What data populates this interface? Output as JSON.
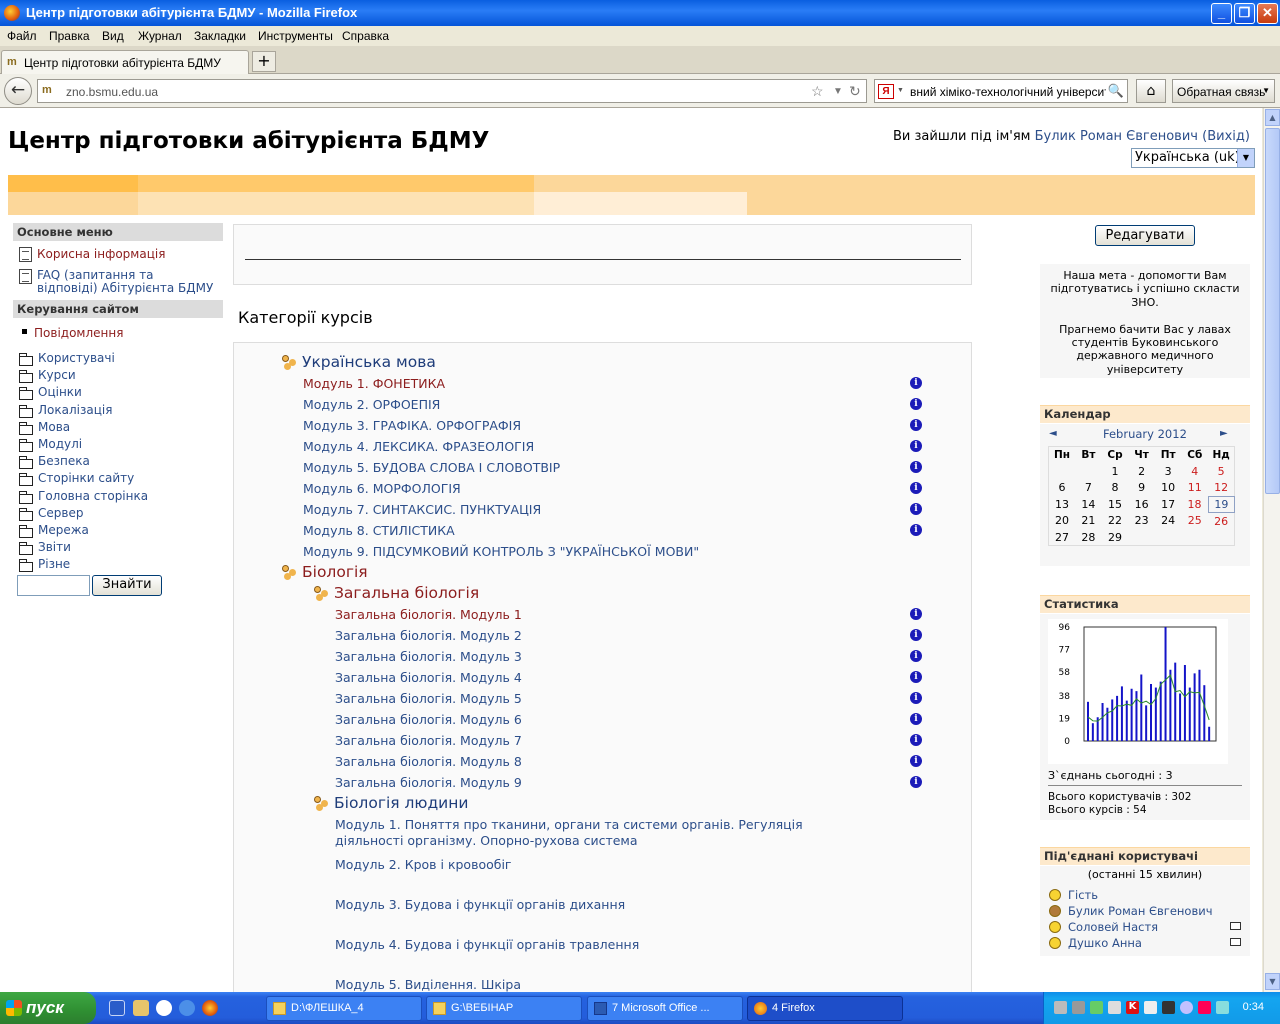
{
  "window": {
    "title": "Центр підготовки абітурієнта БДМУ - Mozilla Firefox",
    "buttons": [
      "_",
      "❐",
      "✕"
    ]
  },
  "menu": [
    "Файл",
    "Правка",
    "Вид",
    "Журнал",
    "Закладки",
    "Инструменты",
    "Справка"
  ],
  "tab": {
    "label": "Центр підготовки абітурієнта БДМУ",
    "favicon": "m",
    "new_tab": "+"
  },
  "nav": {
    "url": "zno.bsmu.edu.ua",
    "search_text": "вний хіміко-технологічний університет",
    "search_engine": "Я",
    "feedback": "Обратная связь"
  },
  "header": {
    "site_title": "Центр підготовки абітурієнта БДМУ",
    "login_prefix": "Ви зайшли під ім'ям",
    "user": "Булик Роман Євгенович",
    "logout": "(Вихід)",
    "language": "Українська (uk)"
  },
  "left": {
    "main_menu_title": "Основне меню",
    "main_menu": [
      {
        "label": "Корисна інформація"
      },
      {
        "label": "FAQ (запитання та відповіді) Абітурієнта БДМУ"
      }
    ],
    "admin_title": "Керування сайтом",
    "admin_items": [
      "Повідомлення",
      "Користувачі",
      "Курси",
      "Оцінки",
      "Локалізація",
      "Мова",
      "Модулі",
      "Безпека",
      "Сторінки сайту",
      "Головна сторінка",
      "Сервер",
      "Мережа",
      "Звіти",
      "Різне"
    ],
    "search_button": "Знайти"
  },
  "main": {
    "categories_title": "Категорії курсів",
    "ukrainian": {
      "title": "Українська мова",
      "courses": [
        "Модуль 1. ФОНЕТИКА",
        "Модуль 2. ОРФОЕПІЯ",
        "Модуль 3. ГРАФІКА. ОРФОГРАФІЯ",
        "Модуль 4. ЛЕКСИКА. ФРАЗЕОЛОГІЯ",
        "Модуль 5. БУДОВА СЛОВА І СЛОВОТВІР",
        "Модуль 6. МОРФОЛОГІЯ",
        "Модуль 7. СИНТАКСИС. ПУНКТУАЦІЯ",
        "Модуль 8. СТИЛІСТИКА",
        "Модуль 9. ПІДСУМКОВИЙ КОНТРОЛЬ З \"УКРАЇНСЬКОЇ МОВИ\""
      ]
    },
    "biology": {
      "title": "Біологія"
    },
    "general_biology": {
      "title": "Загальна біологія",
      "courses": [
        "Загальна біологія. Модуль 1",
        "Загальна біологія. Модуль 2",
        "Загальна біологія. Модуль 3",
        "Загальна біологія. Модуль 4",
        "Загальна біологія. Модуль 5",
        "Загальна біологія. Модуль 6",
        "Загальна біологія. Модуль 7",
        "Загальна біологія. Модуль 8",
        "Загальна біологія. Модуль 9"
      ]
    },
    "human_biology": {
      "title": "Біологія людини",
      "courses": [
        "Модуль 1. Поняття про тканини, органи та системи органів. Регуляція",
        "діяльності організму. Опорно-рухова система",
        "Модуль 2. Кров і кровообіг",
        "Модуль 3. Будова і функції органів дихання",
        "Модуль 4. Будова і функції органів травлення",
        "Модуль 5. Виділення. Шкіра"
      ]
    },
    "info_icon": "i"
  },
  "right": {
    "edit_button": "Редагувати",
    "goal_text_1": "Наша мета - допомогти Вам підготуватись і успішно скласти ЗНО.",
    "goal_text_2": "Прагнемо бачити Вас у лавах студентів Буковинського державного медичного університету",
    "calendar": {
      "title": "Календар",
      "month": "February 2012",
      "prev": "◄",
      "next": "►",
      "days": [
        "Пн",
        "Вт",
        "Ср",
        "Чт",
        "Пт",
        "Сб",
        "Нд"
      ],
      "weeks": [
        [
          "",
          "",
          "1",
          "2",
          "3",
          "4",
          "5"
        ],
        [
          "6",
          "7",
          "8",
          "9",
          "10",
          "11",
          "12"
        ],
        [
          "13",
          "14",
          "15",
          "16",
          "17",
          "18",
          "19"
        ],
        [
          "20",
          "21",
          "22",
          "23",
          "24",
          "25",
          "26"
        ],
        [
          "27",
          "28",
          "29",
          "",
          "",
          "",
          ""
        ]
      ]
    },
    "stats": {
      "title": "Статистика",
      "today": "З`єднань сьогодні : 3",
      "users": "Всього користувачів : 302",
      "courses": "Всього курсів : 54"
    },
    "online": {
      "title": "Під'єднані користувачі",
      "subtitle": "(останні 15 хвилин)",
      "users": [
        "Гість",
        "Булик Роман Євгенович",
        "Соловей Настя",
        "Душко Анна"
      ]
    }
  },
  "chart_data": {
    "type": "bar",
    "title": "",
    "ylim": [
      0,
      96
    ],
    "yticks": [
      "96",
      "77",
      "58",
      "38",
      "19",
      "0"
    ],
    "series": [
      {
        "values": [
          33,
          15,
          20,
          32,
          28,
          35,
          38,
          46,
          34,
          44,
          42,
          56,
          30,
          48,
          45,
          50,
          96,
          60,
          66,
          40,
          64,
          45,
          57,
          60,
          47,
          12
        ]
      }
    ]
  },
  "taskbar": {
    "start": "пуск",
    "tasks": [
      "D:\\ФЛЕШКА_4",
      "G:\\ВЕБІНАР",
      "7 Microsoft Office ...",
      "4 Firefox"
    ],
    "clock": "0:34"
  }
}
